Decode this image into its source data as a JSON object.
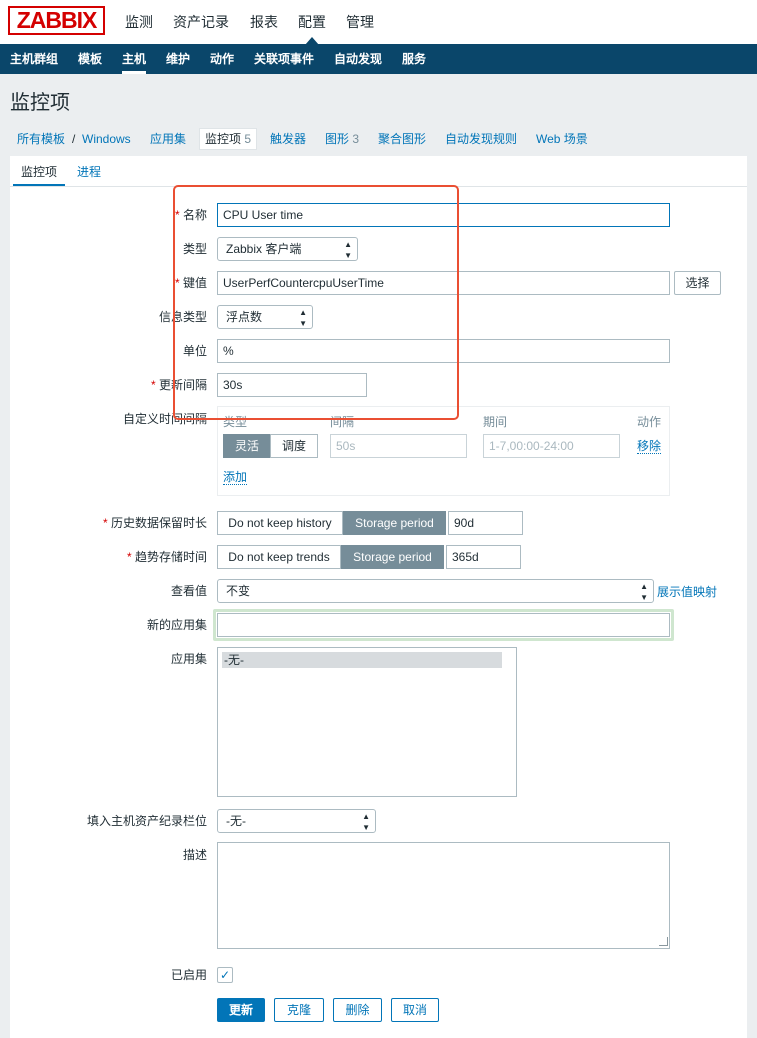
{
  "logo": "ZABBIX",
  "top_menu": [
    "监测",
    "资产记录",
    "报表",
    "配置",
    "管理"
  ],
  "sub_menu": [
    "主机群组",
    "模板",
    "主机",
    "维护",
    "动作",
    "关联项事件",
    "自动发现",
    "服务"
  ],
  "page_title": "监控项",
  "breadcrumb": {
    "all_templates": "所有模板",
    "separator": "/",
    "template": "Windows",
    "applications": "应用集",
    "items": "监控项",
    "items_count": "5",
    "triggers": "触发器",
    "graphs": "图形",
    "graphs_count": "3",
    "screens": "聚合图形",
    "discovery": "自动发现规则",
    "web": "Web 场景"
  },
  "tabs": [
    "监控项",
    "进程"
  ],
  "form": {
    "name_label": "名称",
    "name_value": "CPU User time",
    "type_label": "类型",
    "type_value": "Zabbix 客户端",
    "key_label": "键值",
    "key_value": "UserPerfCountercpuUserTime",
    "select_button": "选择",
    "info_type_label": "信息类型",
    "info_type_value": "浮点数",
    "units_label": "单位",
    "units_value": "%",
    "interval_label": "更新间隔",
    "interval_value": "30s",
    "custom_interval_label": "自定义时间间隔",
    "custom_interval": {
      "col_type": "类型",
      "col_interval": "间隔",
      "col_period": "期间",
      "col_action": "动作",
      "flexible": "灵活",
      "scheduling": "调度",
      "interval_placeholder": "50s",
      "period_placeholder": "1-7,00:00-24:00",
      "remove": "移除",
      "add": "添加"
    },
    "history_label": "历史数据保留时长",
    "history_no_keep": "Do not keep history",
    "history_storage": "Storage period",
    "history_value": "90d",
    "trends_label": "趋势存储时间",
    "trends_no_keep": "Do not keep trends",
    "trends_storage": "Storage period",
    "trends_value": "365d",
    "valuemap_label": "查看值",
    "valuemap_value": "不变",
    "valuemap_link": "展示值映射",
    "new_app_label": "新的应用集",
    "new_app_value": "",
    "apps_label": "应用集",
    "apps_options": [
      "-无-"
    ],
    "inventory_label": "填入主机资产纪录栏位",
    "inventory_value": "-无-",
    "description_label": "描述",
    "description_value": "",
    "enabled_label": "已启用",
    "enabled_check": "✓"
  },
  "buttons": {
    "update": "更新",
    "clone": "克隆",
    "delete": "删除",
    "cancel": "取消"
  },
  "colors": {
    "brand_red": "#d40000",
    "nav_dark": "#0a466a",
    "primary": "#0275b8",
    "segment_active": "#768d99",
    "annotation": "#ea4f33"
  }
}
